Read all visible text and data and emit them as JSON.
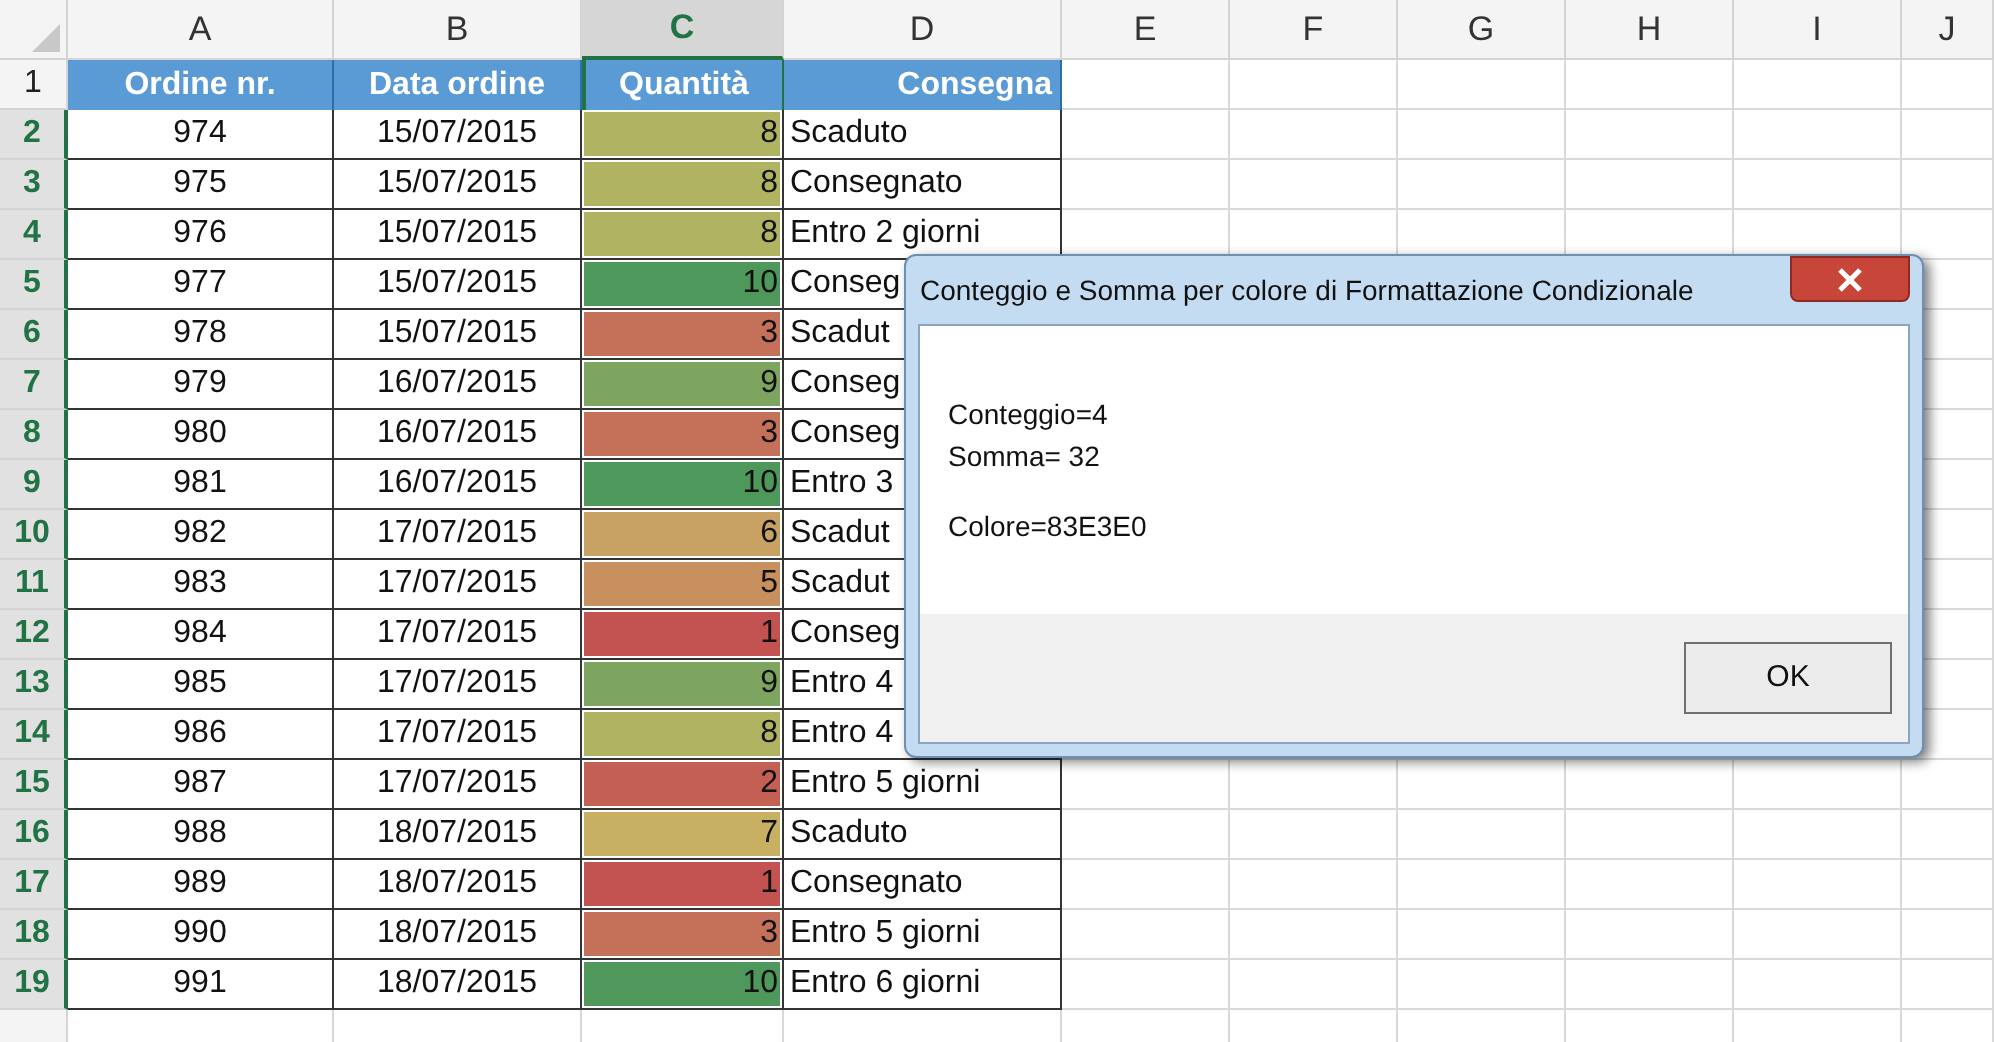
{
  "sheet": {
    "columns": [
      {
        "label": "A",
        "selected": false
      },
      {
        "label": "B",
        "selected": false
      },
      {
        "label": "C",
        "selected": true
      },
      {
        "label": "D",
        "selected": false
      },
      {
        "label": "E",
        "selected": false
      },
      {
        "label": "F",
        "selected": false
      },
      {
        "label": "G",
        "selected": false
      },
      {
        "label": "H",
        "selected": false
      },
      {
        "label": "I",
        "selected": false
      },
      {
        "label": "J",
        "selected": false
      }
    ],
    "header": {
      "row": "1",
      "selected": false,
      "cells": [
        "Ordine nr.",
        "Data ordine",
        "Quantità",
        "Consegna"
      ]
    },
    "rows": [
      {
        "row": "2",
        "selected": true,
        "order": "974",
        "date": "15/07/2015",
        "quantity": "8",
        "color": "#b0b462",
        "delivery": "Scaduto"
      },
      {
        "row": "3",
        "selected": true,
        "order": "975",
        "date": "15/07/2015",
        "quantity": "8",
        "color": "#b0b462",
        "delivery": "Consegnato"
      },
      {
        "row": "4",
        "selected": true,
        "order": "976",
        "date": "15/07/2015",
        "quantity": "8",
        "color": "#b0b462",
        "delivery": "Entro 2 giorni"
      },
      {
        "row": "5",
        "selected": true,
        "order": "977",
        "date": "15/07/2015",
        "quantity": "10",
        "color": "#4e985c",
        "delivery": "Conseg"
      },
      {
        "row": "6",
        "selected": true,
        "order": "978",
        "date": "15/07/2015",
        "quantity": "3",
        "color": "#c5715a",
        "delivery": "Scadut"
      },
      {
        "row": "7",
        "selected": true,
        "order": "979",
        "date": "16/07/2015",
        "quantity": "9",
        "color": "#7ea55f",
        "delivery": "Conseg"
      },
      {
        "row": "8",
        "selected": true,
        "order": "980",
        "date": "16/07/2015",
        "quantity": "3",
        "color": "#c5715a",
        "delivery": "Conseg"
      },
      {
        "row": "9",
        "selected": true,
        "order": "981",
        "date": "16/07/2015",
        "quantity": "10",
        "color": "#4e985c",
        "delivery": "Entro 3"
      },
      {
        "row": "10",
        "selected": true,
        "order": "982",
        "date": "17/07/2015",
        "quantity": "6",
        "color": "#c8a262",
        "delivery": "Scadut"
      },
      {
        "row": "11",
        "selected": true,
        "order": "983",
        "date": "17/07/2015",
        "quantity": "5",
        "color": "#c88f5f",
        "delivery": "Scadut"
      },
      {
        "row": "12",
        "selected": true,
        "order": "984",
        "date": "17/07/2015",
        "quantity": "1",
        "color": "#c25350",
        "delivery": "Conseg"
      },
      {
        "row": "13",
        "selected": true,
        "order": "985",
        "date": "17/07/2015",
        "quantity": "9",
        "color": "#7ea55f",
        "delivery": "Entro 4"
      },
      {
        "row": "14",
        "selected": true,
        "order": "986",
        "date": "17/07/2015",
        "quantity": "8",
        "color": "#b0b462",
        "delivery": "Entro 4"
      },
      {
        "row": "15",
        "selected": true,
        "order": "987",
        "date": "17/07/2015",
        "quantity": "2",
        "color": "#c35f53",
        "delivery": "Entro 5 giorni"
      },
      {
        "row": "16",
        "selected": true,
        "order": "988",
        "date": "18/07/2015",
        "quantity": "7",
        "color": "#c8b063",
        "delivery": "Scaduto"
      },
      {
        "row": "17",
        "selected": true,
        "order": "989",
        "date": "18/07/2015",
        "quantity": "1",
        "color": "#c25350",
        "delivery": "Consegnato"
      },
      {
        "row": "18",
        "selected": true,
        "order": "990",
        "date": "18/07/2015",
        "quantity": "3",
        "color": "#c5715a",
        "delivery": "Entro 5 giorni"
      },
      {
        "row": "19",
        "selected": true,
        "order": "991",
        "date": "18/07/2015",
        "quantity": "10",
        "color": "#4e985c",
        "delivery": "Entro 6 giorni"
      }
    ]
  },
  "dialog": {
    "title": "Conteggio e Somma per colore di Formattazione Condizionale",
    "message": [
      [
        "Conteggio=4",
        "Somma= 32"
      ],
      [
        "Colore=83E3E0"
      ]
    ],
    "ok_button": "OK"
  }
}
